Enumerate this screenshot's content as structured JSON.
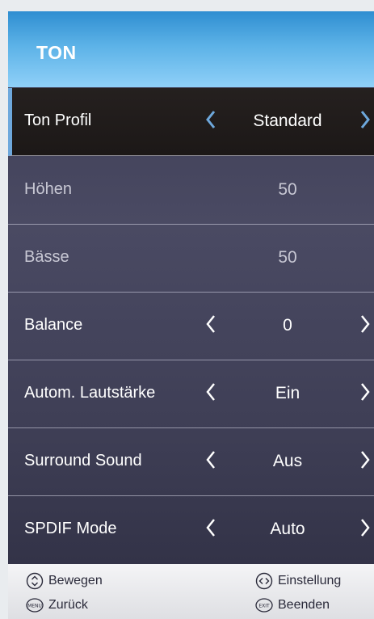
{
  "menu": {
    "title": "TON",
    "rows": [
      {
        "label": "Ton Profil",
        "value": "Standard"
      },
      {
        "label": "Höhen",
        "value": "50"
      },
      {
        "label": "Bässe",
        "value": "50"
      },
      {
        "label": "Balance",
        "value": "0"
      },
      {
        "label": "Autom. Lautstärke",
        "value": "Ein"
      },
      {
        "label": "Surround Sound",
        "value": "Aus"
      },
      {
        "label": "SPDIF Mode",
        "value": "Auto"
      }
    ]
  },
  "footer": {
    "move_label": "Bewegen",
    "adjust_label": "Einstellung",
    "back_label": "Zurück",
    "exit_label": "Beenden",
    "menu_key": "MENU",
    "exit_key": "EXIT"
  },
  "colors": {
    "header": "#5cb2e7",
    "selected_bg": "#1f1a19",
    "accent": "#6ea8dc"
  }
}
